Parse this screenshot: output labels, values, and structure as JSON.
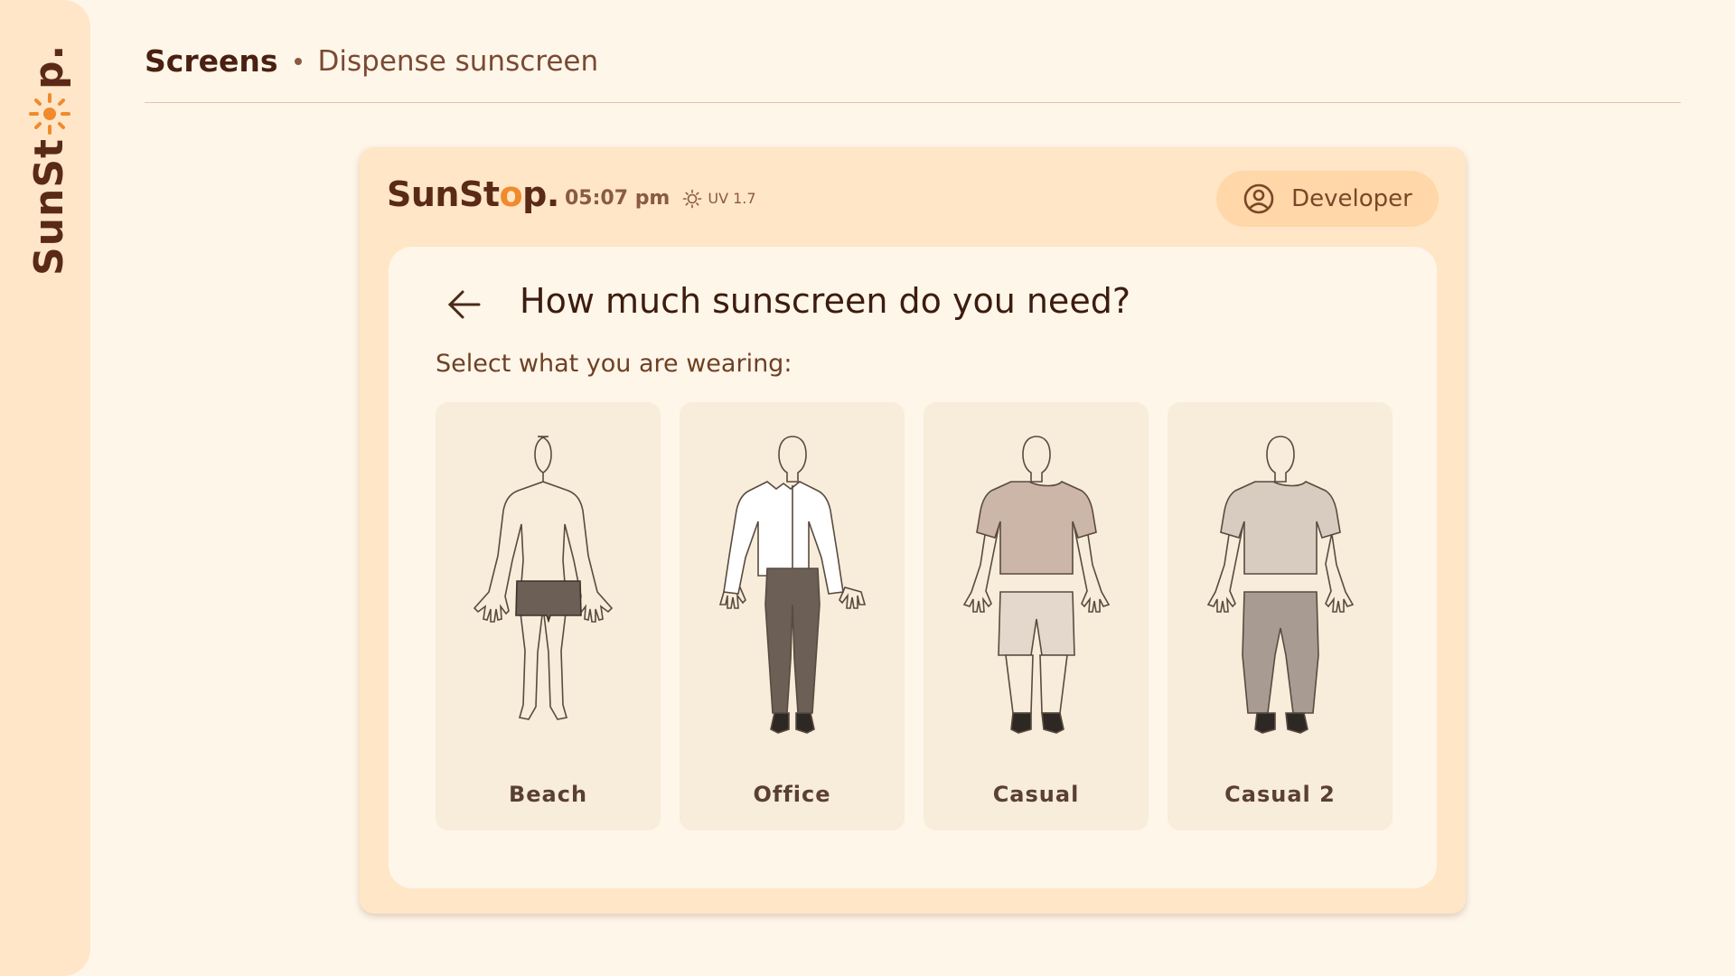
{
  "rail": {
    "brand_prefix": "SunSt",
    "brand_suffix": "p.",
    "icon": "sun-icon"
  },
  "header": {
    "section": "Screens",
    "page": "Dispense sunscreen"
  },
  "device": {
    "logo_prefix": "SunSt",
    "logo_o": "o",
    "logo_suffix": "p.",
    "time": "05:07 pm",
    "uv_label": "UV 1.7",
    "uv_icon": "sun-icon",
    "user_button": {
      "label": "Developer",
      "icon": "user-circle-icon"
    }
  },
  "panel": {
    "back_icon": "arrow-left-icon",
    "title": "How much sunscreen do you need?",
    "subtitle": "Select what you are wearing:",
    "options": [
      {
        "label": "Beach"
      },
      {
        "label": "Office"
      },
      {
        "label": "Casual"
      },
      {
        "label": "Casual 2"
      }
    ]
  },
  "colors": {
    "background": "#fff6ea",
    "rail": "#ffe6c8",
    "device_frame": "#ffe6c6",
    "accent_orange": "#f08a2c",
    "brand_brown": "#5a2a16",
    "card": "#f8ecda",
    "button": "#ffd7a8"
  }
}
